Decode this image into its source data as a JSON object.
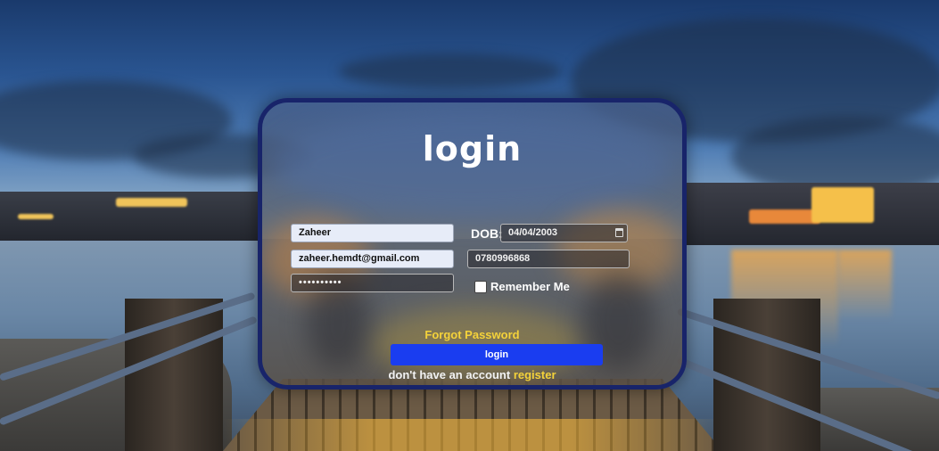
{
  "login": {
    "title": "login",
    "name_value": "Zaheer",
    "dob_label": "DOB:",
    "dob_value": "04/04/2003",
    "email_value": "zaheer.hemdt@gmail.com",
    "phone_value": "0780996868",
    "password_value": "••••••••••",
    "remember_label": "Remember Me",
    "remember_checked": false,
    "forgot_label": "Forgot Password",
    "login_button_label": "login",
    "no_account_text": "don't have an account",
    "register_label": "register"
  },
  "theme": {
    "accent_button": "#1a3df0",
    "link_color": "#f4d23a",
    "card_border": "#18246a"
  },
  "icons": {
    "date_picker": "calendar-icon"
  }
}
